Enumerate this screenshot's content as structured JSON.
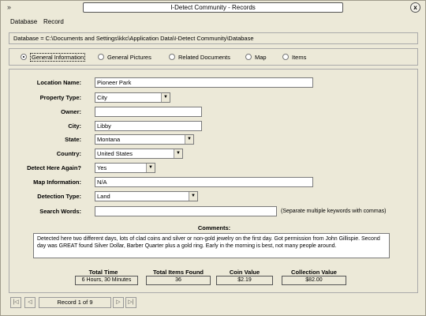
{
  "window": {
    "title": "I-Detect Community - Records",
    "close_label": "x",
    "sys_icon": "double-chevron-icon"
  },
  "menu": {
    "items": [
      "Database",
      "Record"
    ]
  },
  "path": "Database = C:\\Documents and Settings\\kkc\\Application Data\\I-Detect Community\\Database",
  "tabs": [
    {
      "label": "General Information",
      "selected": true
    },
    {
      "label": "General Pictures",
      "selected": false
    },
    {
      "label": "Related Documents",
      "selected": false
    },
    {
      "label": "Map",
      "selected": false
    },
    {
      "label": "Items",
      "selected": false
    }
  ],
  "form": {
    "location_name": {
      "label": "Location Name:",
      "value": "Pioneer Park"
    },
    "property_type": {
      "label": "Property Type:",
      "value": "City"
    },
    "owner": {
      "label": "Owner:",
      "value": ""
    },
    "city": {
      "label": "City:",
      "value": "Libby"
    },
    "state": {
      "label": "State:",
      "value": "Montana"
    },
    "country": {
      "label": "Country:",
      "value": "United States"
    },
    "detect_again": {
      "label": "Detect Here Again?",
      "value": "Yes"
    },
    "map_info": {
      "label": "Map Information:",
      "value": "N/A"
    },
    "detection_type": {
      "label": "Detection Type:",
      "value": "Land"
    },
    "search_words": {
      "label": "Search Words:",
      "value": "",
      "hint": "(Separate multiple keywords with commas)"
    }
  },
  "comments": {
    "label": "Comments:",
    "text": "Detected here two different days, lots of clad coins and silver or non-gold jewelry on the first day. Got permission from John Gillispie. Second day was GREAT found Silver Dollar, Barber Quarter plus a gold ring. Early in the morning is best, not many people around."
  },
  "stats": [
    {
      "label": "Total Time",
      "value": "6 Hours, 30 Minutes"
    },
    {
      "label": "Total Items Found",
      "value": "36"
    },
    {
      "label": "Coin Value",
      "value": "$2.19"
    },
    {
      "label": "Collection Value",
      "value": "$82.00"
    }
  ],
  "navigator": {
    "record_text": "Record 1 of 9",
    "first": "|◁",
    "prev": "◁",
    "next": "▷",
    "last": "▷|"
  }
}
